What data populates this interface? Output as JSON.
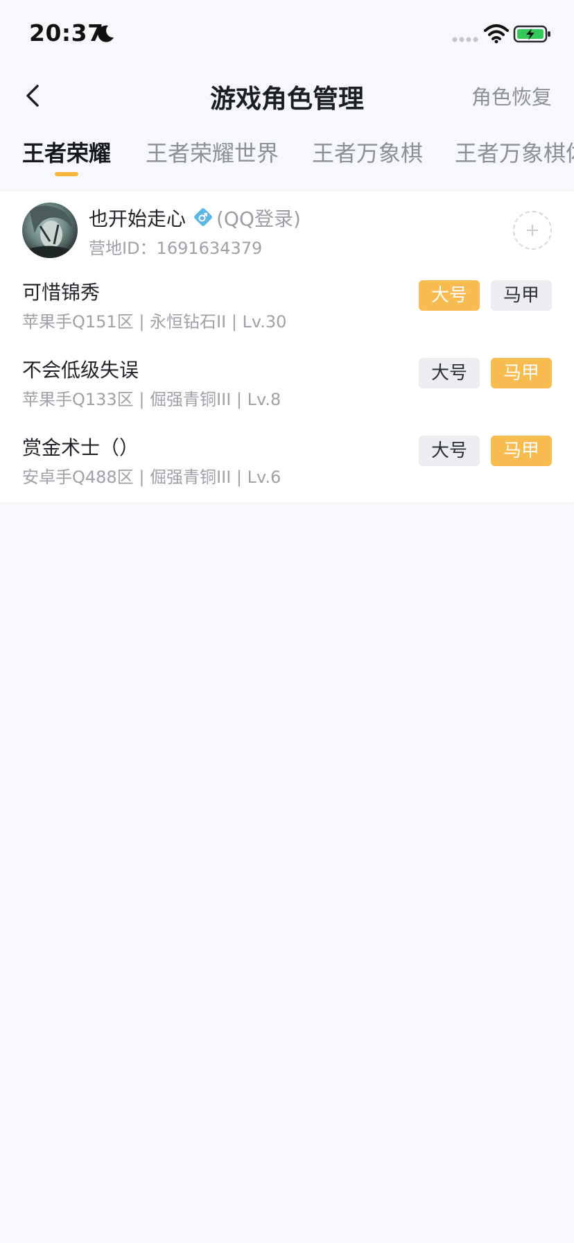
{
  "status_bar": {
    "time": "20:37"
  },
  "nav": {
    "title": "游戏角色管理",
    "restore_label": "角色恢复"
  },
  "tabs": [
    {
      "label": "王者荣耀",
      "active": true
    },
    {
      "label": "王者荣耀世界",
      "active": false
    },
    {
      "label": "王者万象棋",
      "active": false
    },
    {
      "label": "王者万象棋体",
      "active": false
    }
  ],
  "account": {
    "name": "也开始走心",
    "login_type": "(QQ登录)",
    "camp_id": "营地ID：1691634379"
  },
  "roles": [
    {
      "name": "可惜锦秀",
      "detail": "苹果手Q151区 | 永恒钻石II | Lv.30",
      "main_label": "大号",
      "alt_label": "马甲",
      "selected": "main"
    },
    {
      "name": "不会低级失误",
      "detail": "苹果手Q133区 | 倔强青铜III | Lv.8",
      "main_label": "大号",
      "alt_label": "马甲",
      "selected": "alt"
    },
    {
      "name": "赏金术士（）",
      "detail": "安卓手Q488区 | 倔强青铜III | Lv.6",
      "main_label": "大号",
      "alt_label": "马甲",
      "selected": "alt"
    }
  ],
  "colors": {
    "accent": "#f8bb4f",
    "tag_off_bg": "#eceef2",
    "background": "#f7f8fc"
  },
  "icons": [
    "back-arrow-icon",
    "moon-icon",
    "signal-icon",
    "wifi-icon",
    "battery-charging-icon",
    "male-gender-icon",
    "plus-icon"
  ]
}
